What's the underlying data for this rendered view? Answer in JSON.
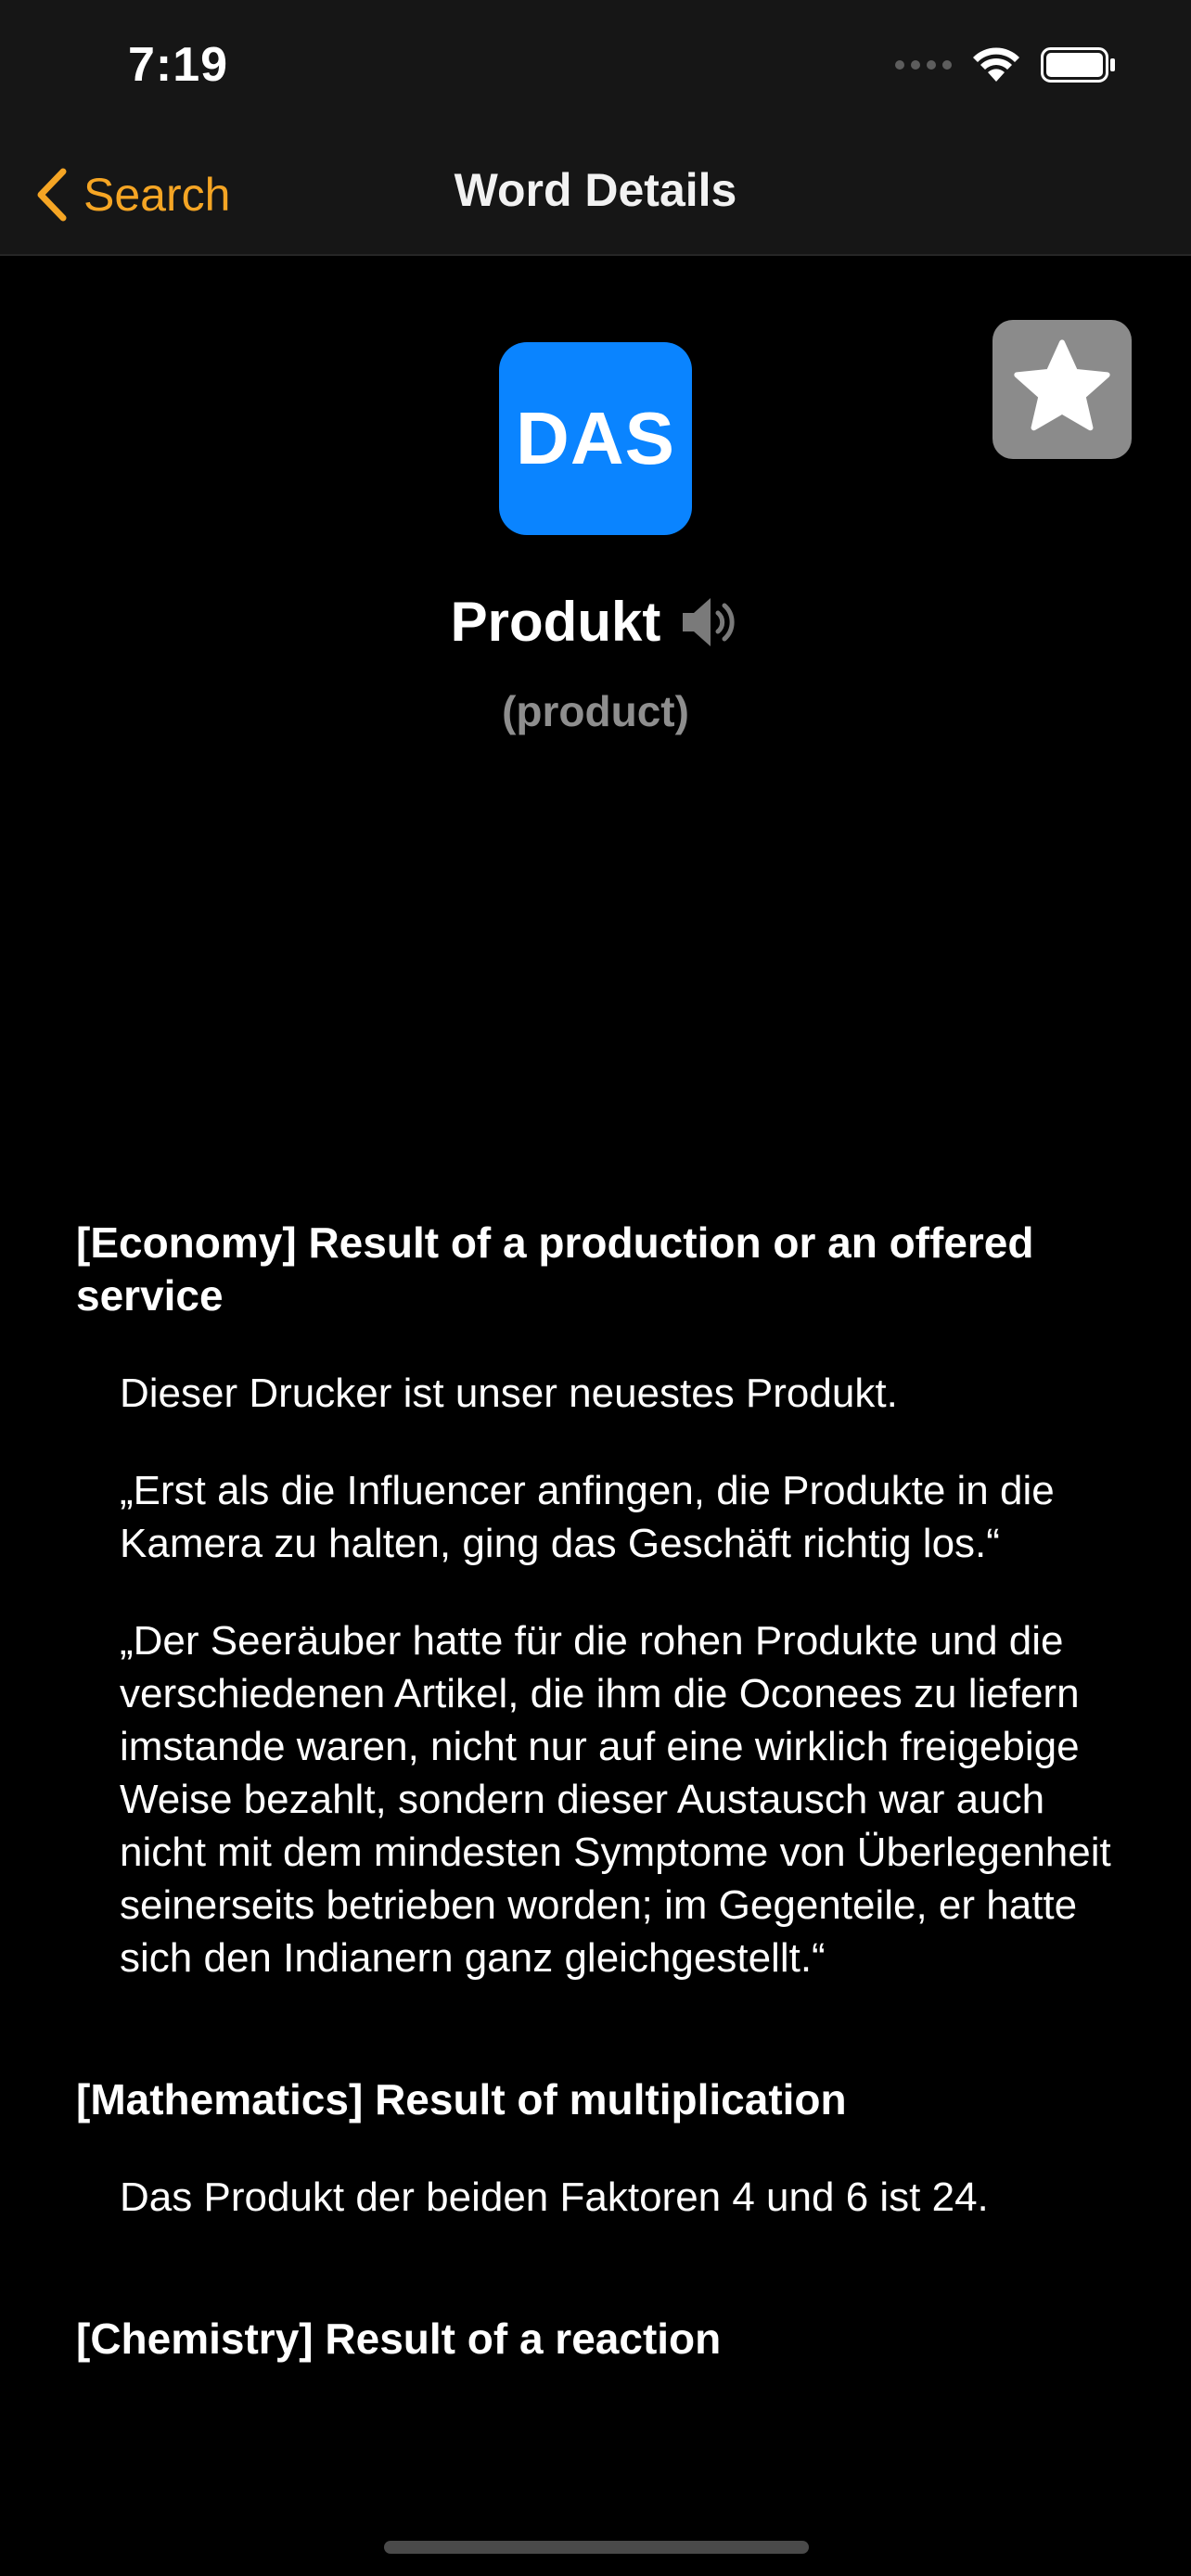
{
  "status_bar": {
    "time": "7:19"
  },
  "nav": {
    "back_label": "Search",
    "title": "Word Details"
  },
  "word": {
    "article": "DAS",
    "text": "Produkt",
    "translation": "(product)"
  },
  "colors": {
    "accent": "#f5a524",
    "article_badge": "#0a84ff",
    "favorite_bg": "#8b8b8b"
  },
  "icons": {
    "back": "chevron-left-icon",
    "favorite": "star-icon",
    "speaker": "speaker-icon",
    "wifi": "wifi-icon",
    "battery": "battery-icon"
  },
  "definitions": [
    {
      "heading": "[Economy] Result of a production or an offered service",
      "examples": [
        "Dieser Drucker ist unser neuestes Produkt.",
        "„Erst als die Influencer anfingen, die Produkte in die Kamera zu halten, ging das Geschäft richtig los.“",
        "„Der Seeräuber hatte für die rohen Produkte und die verschiedenen Artikel, die ihm die Oconees zu liefern imstande waren, nicht nur auf eine wirklich freigebige Weise bezahlt, sondern dieser Austausch war auch nicht mit dem mindesten Symptome von Überlegenheit seinerseits betrieben worden; im Gegenteile, er hatte sich den Indianern ganz gleichgestellt.“"
      ]
    },
    {
      "heading": "[Mathematics] Result of multiplication",
      "examples": [
        "Das Produkt der beiden Faktoren 4 und 6 ist 24."
      ]
    },
    {
      "heading": "[Chemistry] Result of a reaction",
      "examples": []
    }
  ]
}
